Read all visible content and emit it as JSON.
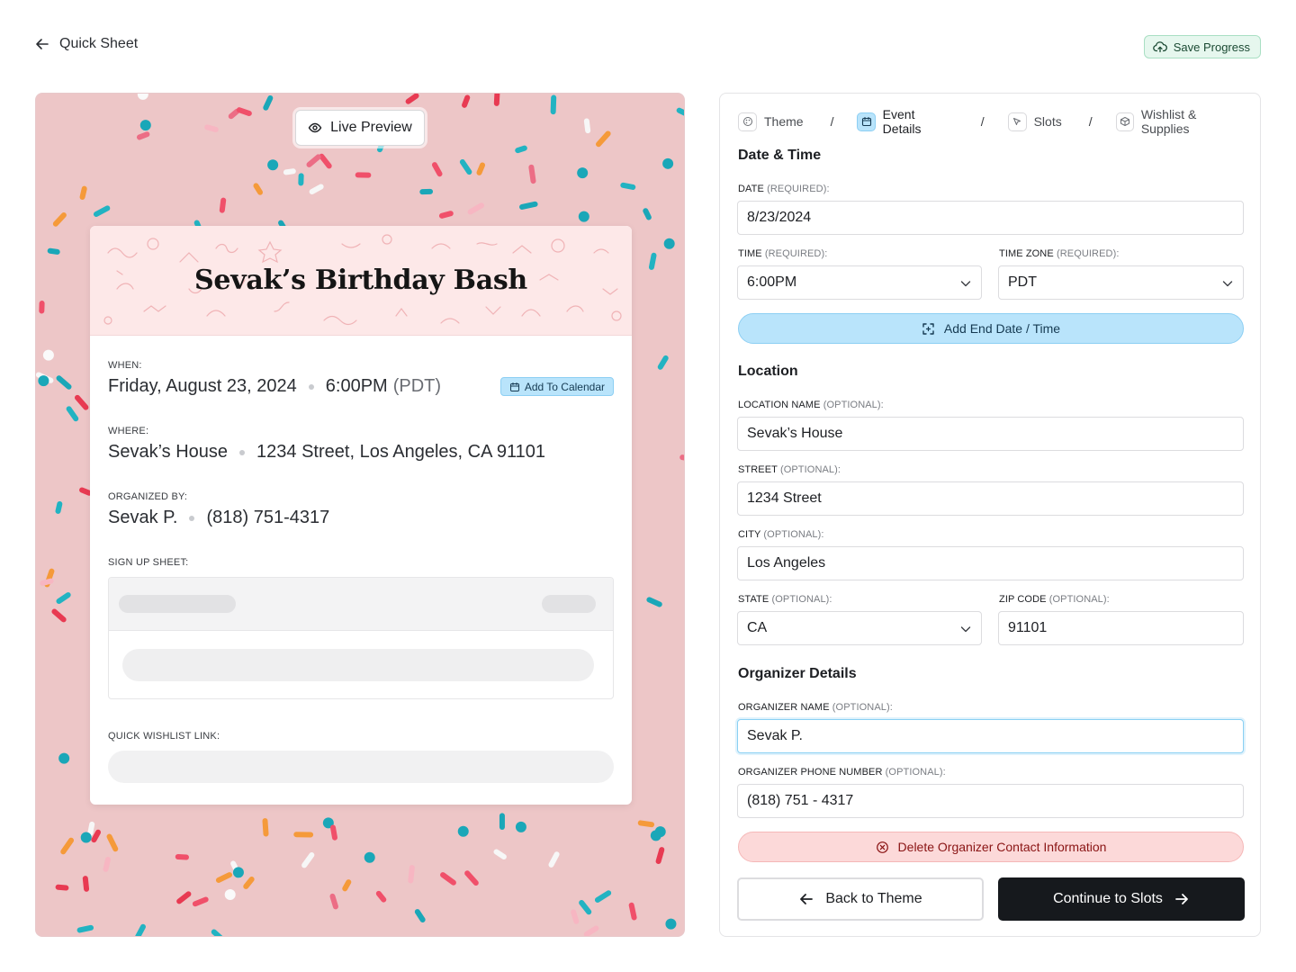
{
  "header": {
    "back_label": "Quick Sheet",
    "save_label": "Save Progress"
  },
  "preview": {
    "live_label": "Live Preview",
    "event_title": "Sevak’s Birthday Bash",
    "when_label": "WHEN:",
    "when_date": "Friday, August 23, 2024",
    "when_time": "6:00PM",
    "when_zone": "(PDT)",
    "add_calendar_label": "Add To Calendar",
    "where_label": "WHERE:",
    "where_name": "Sevak’s House",
    "where_address": "1234 Street, Los Angeles, CA 91101",
    "organizer_label": "ORGANIZED BY:",
    "organizer_name": "Sevak P.",
    "organizer_phone": "(818) 751-4317",
    "signup_label": "SIGN UP SHEET:",
    "wishlist_label": "QUICK WISHLIST LINK:"
  },
  "steps": [
    {
      "label": "Theme",
      "icon": "palette-icon",
      "active": false
    },
    {
      "label": "Event Details",
      "icon": "calendar-icon",
      "active": true
    },
    {
      "label": "Slots",
      "icon": "cursor-icon",
      "active": false
    },
    {
      "label": "Wishlist & Supplies",
      "icon": "box-icon",
      "active": false
    }
  ],
  "step_separator": "/",
  "form": {
    "datetime_section": "Date & Time",
    "date_label": "DATE",
    "date_req": "(REQUIRED):",
    "date_value": "8/23/2024",
    "time_label": "TIME",
    "time_req": "(REQUIRED):",
    "time_value": "6:00PM",
    "tz_label": "TIME ZONE",
    "tz_req": "(REQUIRED):",
    "tz_value": "PDT",
    "add_end_label": "Add End Date / Time",
    "location_section": "Location",
    "loc_name_label": "LOCATION NAME",
    "loc_name_opt": "(OPTIONAL):",
    "loc_name_value": "Sevak’s House",
    "street_label": "STREET",
    "street_opt": "(OPTIONAL):",
    "street_value": "1234 Street",
    "city_label": "CITY",
    "city_opt": "(OPTIONAL):",
    "city_value": "Los Angeles",
    "state_label": "STATE",
    "state_opt": "(OPTIONAL):",
    "state_value": "CA",
    "zip_label": "ZIP CODE",
    "zip_opt": "(OPTIONAL):",
    "zip_value": "91101",
    "organizer_section": "Organizer Details",
    "org_name_label": "ORGANIZER NAME",
    "org_name_opt": "(OPTIONAL):",
    "org_name_value": "Sevak P.",
    "org_phone_label": "ORGANIZER PHONE NUMBER",
    "org_phone_opt": "(OPTIONAL):",
    "org_phone_value": "(818) 751 - 4317",
    "delete_label": "Delete Organizer Contact Information",
    "back_label": "Back to Theme",
    "continue_label": "Continue to Slots"
  },
  "colors": {
    "accent_blue": "#b9e4fb",
    "danger_bg": "#fcd9d9",
    "save_green": "#e6f7ee",
    "primary_dark": "#16191d",
    "preview_pink": "#edc6c7"
  }
}
